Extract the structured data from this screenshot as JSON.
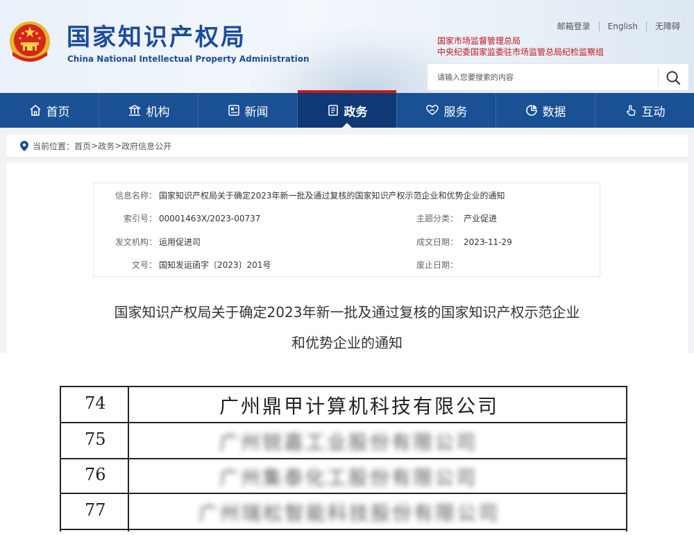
{
  "header": {
    "site_title": "国家知识产权局",
    "site_subtitle": "China National Intellectual Property Administration",
    "top_links": [
      "邮箱登录",
      "English",
      "无障碍"
    ],
    "red_links": [
      "国家市场监督管理总局",
      "中央纪委国家监委驻市场监管总局纪检监察组"
    ],
    "search_placeholder": "请输入您要搜索的内容"
  },
  "nav": {
    "items": [
      {
        "label": "首页",
        "icon": "home-icon"
      },
      {
        "label": "机构",
        "icon": "institution-icon"
      },
      {
        "label": "新闻",
        "icon": "news-icon"
      },
      {
        "label": "政务",
        "icon": "document-icon"
      },
      {
        "label": "服务",
        "icon": "heart-hand-icon"
      },
      {
        "label": "数据",
        "icon": "pie-chart-icon"
      },
      {
        "label": "互动",
        "icon": "touch-icon"
      }
    ],
    "active": "政务"
  },
  "breadcrumb": {
    "prefix": "当前位置：",
    "path": [
      "首页",
      "政务",
      "政府信息公开"
    ],
    "separator": ">"
  },
  "info": {
    "name_label": "信息名称：",
    "name_value": "国家知识产权局关于确定2023年新一批及通过复核的国家知识产权示范企业和优势企业的通知",
    "index_label": "索引号：",
    "index_value": "00001463X/2023-00737",
    "topic_label": "主题分类：",
    "topic_value": "产业促进",
    "issuer_label": "发文机构：",
    "issuer_value": "运用促进司",
    "date_label": "成文日期：",
    "date_value": "2023-11-29",
    "docno_label": "文号：",
    "docno_value": "国知发运函字〔2023〕201号",
    "abolish_label": "废止日期：",
    "abolish_value": ""
  },
  "document": {
    "title_line1": "国家知识产权局关于确定2023年新一批及通过复核的国家知识产权示范企业",
    "title_line2": "和优势企业的通知"
  },
  "scan_table": {
    "rows": [
      {
        "no": "74",
        "name": "广州鼎甲计算机科技有限公司",
        "blurred": false
      },
      {
        "no": "75",
        "name": "广州锐嘉工业股份有限公司",
        "blurred": true
      },
      {
        "no": "76",
        "name": "广州集泰化工股份有限公司",
        "blurred": true
      },
      {
        "no": "77",
        "name": "广州瑞松智能科技股份有限公司",
        "blurred": true
      }
    ]
  }
}
